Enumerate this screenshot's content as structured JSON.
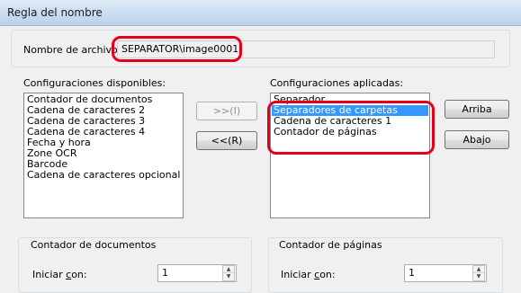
{
  "window": {
    "title": "Regla del nombre"
  },
  "filename": {
    "label": "Nombre de archivo:",
    "value": "SEPARATOR\\image0001"
  },
  "available": {
    "label": "Configuraciones disponibles:",
    "items": [
      "Contador de documentos",
      "Cadena de caracteres 2",
      "Cadena de caracteres 3",
      "Cadena de caracteres 4",
      "Fecha y hora",
      "Zone OCR",
      "Barcode",
      "Cadena de caracteres opcional"
    ]
  },
  "transfer": {
    "add_label": ">>(I)",
    "remove_label": "<<(R)"
  },
  "applied": {
    "label": "Configuraciones aplicadas:",
    "items": [
      "Separador",
      "Separadores de carpetas",
      "Cadena de caracteres 1",
      "Contador de páginas"
    ],
    "selected_index": 1
  },
  "order": {
    "up_label": "Arriba",
    "down_label": "Abajo"
  },
  "doc_counter": {
    "group_label": "Contador de documentos",
    "start_label_prefix": "Iniciar ",
    "start_label_accel": "c",
    "start_label_suffix": "on:",
    "start_value": "1"
  },
  "page_counter": {
    "group_label": "Contador de páginas",
    "start_label_prefix": "Iniciar ",
    "start_label_accel": "c",
    "start_label_suffix": "on:",
    "start_value": "1"
  },
  "colors": {
    "highlight": "#e4001b",
    "selection": "#3399ff"
  }
}
